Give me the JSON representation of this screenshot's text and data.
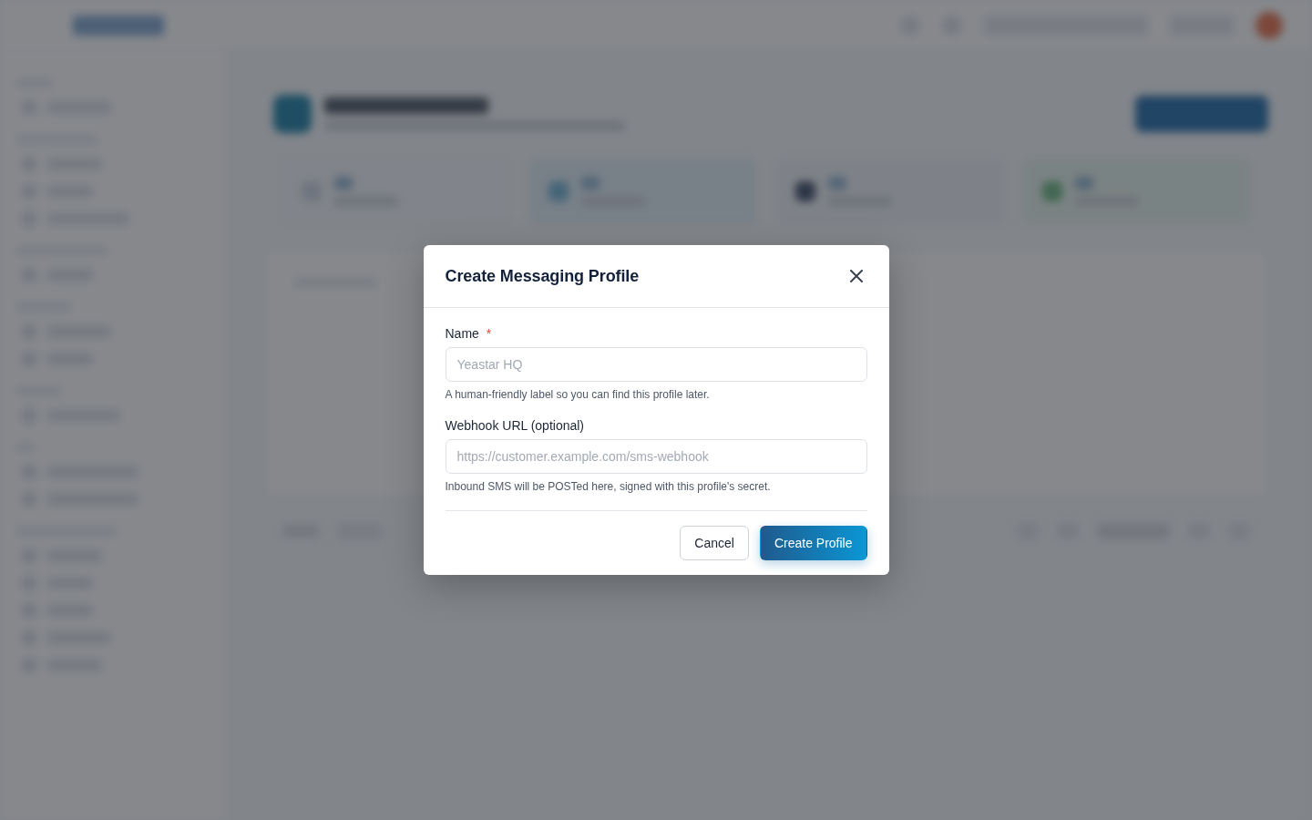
{
  "backdrop": {
    "blurred": true
  },
  "dialog": {
    "title": "Create Messaging Profile",
    "required_marker": "*",
    "fields": [
      {
        "label": "Name",
        "required": true,
        "placeholder": "Yeastar HQ",
        "help": "A human-friendly label so you can find this profile later."
      },
      {
        "label": "Webhook URL (optional)",
        "required": false,
        "placeholder": "https://customer.example.com/sms-webhook",
        "help": "Inbound SMS will be POSTed here, signed with this profile's secret."
      }
    ],
    "buttons": [
      {
        "label": "Cancel",
        "kind": "secondary"
      },
      {
        "label": "Create Profile",
        "kind": "primary"
      }
    ]
  }
}
